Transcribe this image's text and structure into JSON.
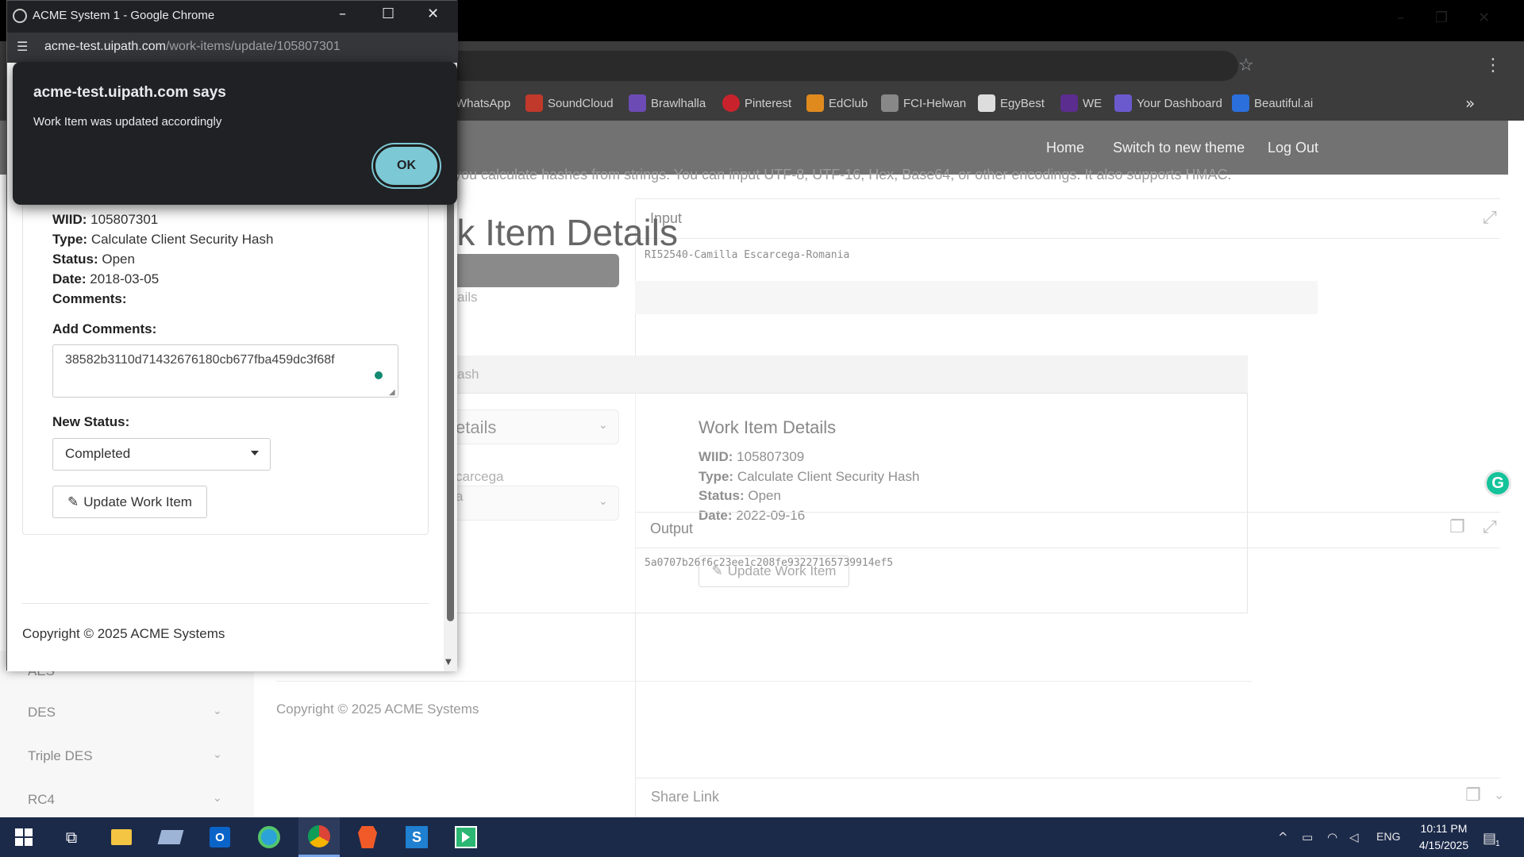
{
  "popup": {
    "window_title": "ACME System 1 - Google Chrome",
    "url_host": "acme-test.uipath.com",
    "url_path": "/work-items/update/105807301",
    "details": {
      "wiid_label": "WIID:",
      "wiid": "105807301",
      "type_label": "Type:",
      "type": "Calculate Client Security Hash",
      "status_label": "Status:",
      "status": "Open",
      "date_label": "Date:",
      "date": "2018-03-05",
      "comments_label": "Comments:"
    },
    "add_comments_label": "Add Comments:",
    "comment_value": "38582b3110d71432676180cb677fba459dc3f68f",
    "new_status_label": "New Status:",
    "new_status_value": "Completed",
    "update_button": "Update Work Item",
    "copyright": "Copyright © 2025 ACME Systems"
  },
  "alert": {
    "title": "acme-test.uipath.com says",
    "message": "Work Item was updated accordingly",
    "ok": "OK"
  },
  "background": {
    "bookmarks": [
      "WhatsApp",
      "SoundCloud",
      "Brawlhalla",
      "Pinterest",
      "EdClub",
      "FCI-Helwan",
      "EgyBest",
      "WE",
      "Your Dashboard",
      "Beautiful.ai"
    ],
    "nav": {
      "home": "Home",
      "switch_theme": "Switch to new theme",
      "logout": "Log Out"
    },
    "intro": "you calculate hashes from strings. You can input UTF-8, UTF-16, Hex, Base64, or other encodings. It also supports HMAC.",
    "page_title": "rk Item Details",
    "frag_ails": "ails",
    "frag_ash": "ash",
    "frag_details": "etails",
    "frag_carcega": "carcega",
    "frag_a": "a",
    "input_label": "Input",
    "input_value": "RI52540-Camilla Escarcega-Romania",
    "output_label": "Output",
    "output_value": "5a0707b26f6c23ee1c208fe93227165739914ef5",
    "share_label": "Share Link",
    "work_item": {
      "title": "Work Item Details",
      "wiid_label": "WIID:",
      "wiid": "105807309",
      "type_label": "Type:",
      "type": "Calculate Client Security Hash",
      "status_label": "Status:",
      "status": "Open",
      "date_label": "Date:",
      "date": "2022-09-16",
      "button": "Update Work Item"
    },
    "sidebar": [
      "AES",
      "DES",
      "Triple DES",
      "RC4"
    ],
    "copyright": "Copyright © 2025 ACME Systems"
  },
  "taskbar": {
    "lang": "ENG",
    "time": "10:11 PM",
    "date": "4/15/2025",
    "notifications": "1"
  }
}
